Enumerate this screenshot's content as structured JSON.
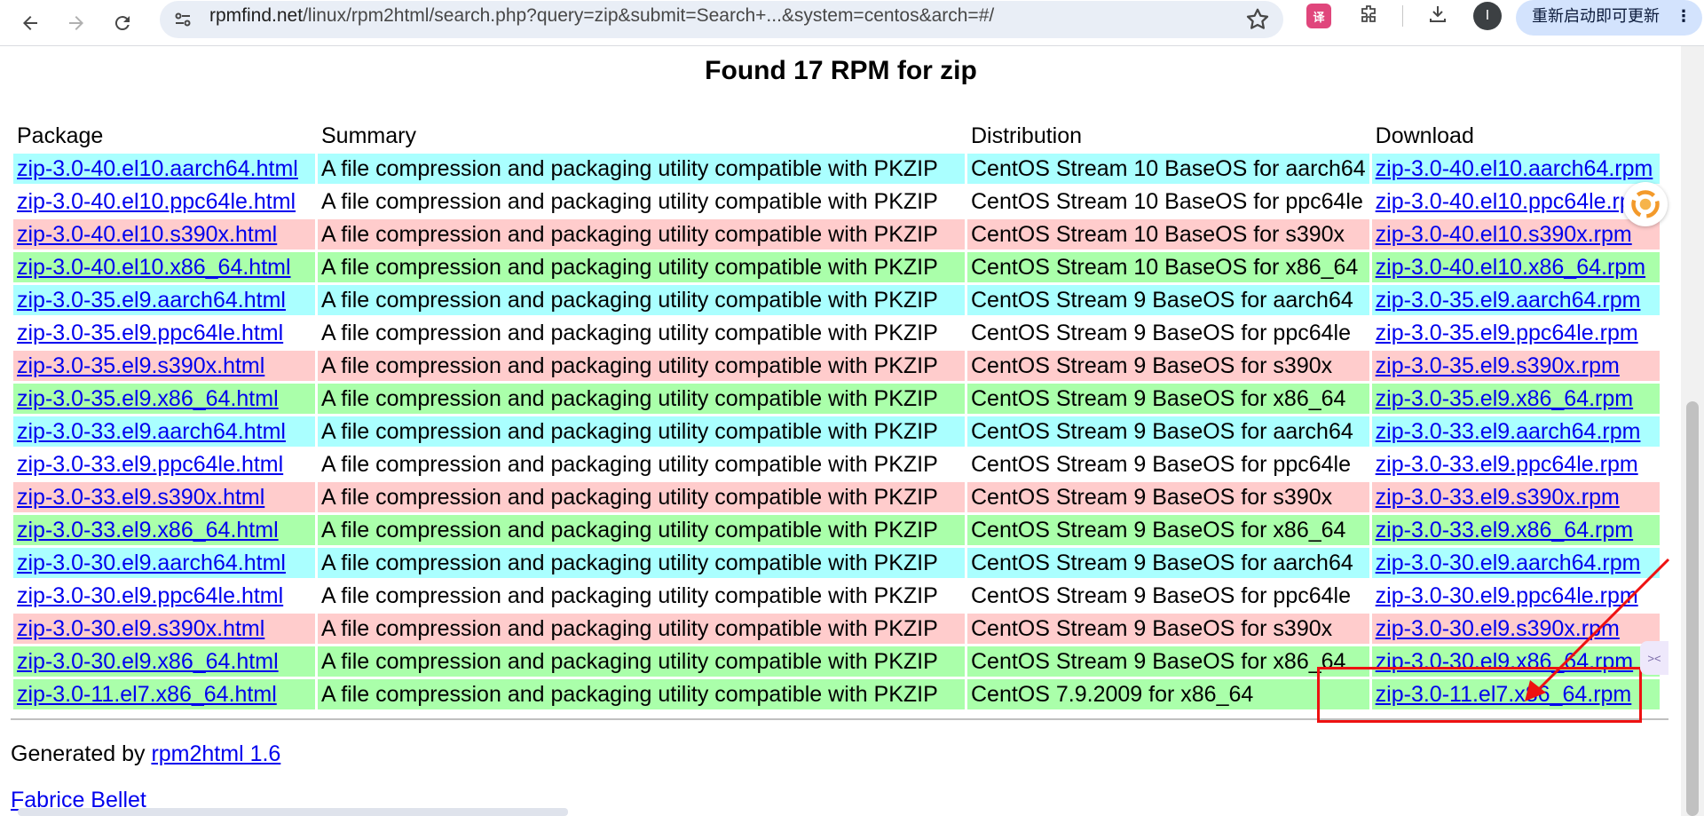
{
  "browser": {
    "url_host": "rpmfind.net",
    "url_path": "/linux/rpm2html/search.php?query=zip&submit=Search+...&system=centos&arch=#/",
    "ext_translate": "译",
    "avatar_initial": "I",
    "update_label": "重新启动即可更新",
    "update_menu": "⋮"
  },
  "page": {
    "heading": "Found 17 RPM for zip",
    "columns": {
      "package": "Package",
      "summary": "Summary",
      "distribution": "Distribution",
      "download": "Download"
    },
    "rows": [
      {
        "package": "zip-3.0-40.el10.aarch64.html",
        "summary": "A file compression and packaging utility compatible with PKZIP",
        "distribution": "CentOS Stream 10 BaseOS for aarch64",
        "download": "zip-3.0-40.el10.aarch64.rpm",
        "color": "cyan"
      },
      {
        "package": "zip-3.0-40.el10.ppc64le.html",
        "summary": "A file compression and packaging utility compatible with PKZIP",
        "distribution": "CentOS Stream 10 BaseOS for ppc64le",
        "download": "zip-3.0-40.el10.ppc64le.rpm",
        "color": "white"
      },
      {
        "package": "zip-3.0-40.el10.s390x.html",
        "summary": "A file compression and packaging utility compatible with PKZIP",
        "distribution": "CentOS Stream 10 BaseOS for s390x",
        "download": "zip-3.0-40.el10.s390x.rpm",
        "color": "pink"
      },
      {
        "package": "zip-3.0-40.el10.x86_64.html",
        "summary": "A file compression and packaging utility compatible with PKZIP",
        "distribution": "CentOS Stream 10 BaseOS for x86_64",
        "download": "zip-3.0-40.el10.x86_64.rpm",
        "color": "green"
      },
      {
        "package": "zip-3.0-35.el9.aarch64.html",
        "summary": "A file compression and packaging utility compatible with PKZIP",
        "distribution": "CentOS Stream 9 BaseOS for aarch64",
        "download": "zip-3.0-35.el9.aarch64.rpm",
        "color": "cyan"
      },
      {
        "package": "zip-3.0-35.el9.ppc64le.html",
        "summary": "A file compression and packaging utility compatible with PKZIP",
        "distribution": "CentOS Stream 9 BaseOS for ppc64le",
        "download": "zip-3.0-35.el9.ppc64le.rpm",
        "color": "white"
      },
      {
        "package": "zip-3.0-35.el9.s390x.html",
        "summary": "A file compression and packaging utility compatible with PKZIP",
        "distribution": "CentOS Stream 9 BaseOS for s390x",
        "download": "zip-3.0-35.el9.s390x.rpm",
        "color": "pink"
      },
      {
        "package": "zip-3.0-35.el9.x86_64.html",
        "summary": "A file compression and packaging utility compatible with PKZIP",
        "distribution": "CentOS Stream 9 BaseOS for x86_64",
        "download": "zip-3.0-35.el9.x86_64.rpm",
        "color": "green"
      },
      {
        "package": "zip-3.0-33.el9.aarch64.html",
        "summary": "A file compression and packaging utility compatible with PKZIP",
        "distribution": "CentOS Stream 9 BaseOS for aarch64",
        "download": "zip-3.0-33.el9.aarch64.rpm",
        "color": "cyan"
      },
      {
        "package": "zip-3.0-33.el9.ppc64le.html",
        "summary": "A file compression and packaging utility compatible with PKZIP",
        "distribution": "CentOS Stream 9 BaseOS for ppc64le",
        "download": "zip-3.0-33.el9.ppc64le.rpm",
        "color": "white"
      },
      {
        "package": "zip-3.0-33.el9.s390x.html",
        "summary": "A file compression and packaging utility compatible with PKZIP",
        "distribution": "CentOS Stream 9 BaseOS for s390x",
        "download": "zip-3.0-33.el9.s390x.rpm",
        "color": "pink"
      },
      {
        "package": "zip-3.0-33.el9.x86_64.html",
        "summary": "A file compression and packaging utility compatible with PKZIP",
        "distribution": "CentOS Stream 9 BaseOS for x86_64",
        "download": "zip-3.0-33.el9.x86_64.rpm",
        "color": "green"
      },
      {
        "package": "zip-3.0-30.el9.aarch64.html",
        "summary": "A file compression and packaging utility compatible with PKZIP",
        "distribution": "CentOS Stream 9 BaseOS for aarch64",
        "download": "zip-3.0-30.el9.aarch64.rpm",
        "color": "cyan"
      },
      {
        "package": "zip-3.0-30.el9.ppc64le.html",
        "summary": "A file compression and packaging utility compatible with PKZIP",
        "distribution": "CentOS Stream 9 BaseOS for ppc64le",
        "download": "zip-3.0-30.el9.ppc64le.rpm",
        "color": "white"
      },
      {
        "package": "zip-3.0-30.el9.s390x.html",
        "summary": "A file compression and packaging utility compatible with PKZIP",
        "distribution": "CentOS Stream 9 BaseOS for s390x",
        "download": "zip-3.0-30.el9.s390x.rpm",
        "color": "pink"
      },
      {
        "package": "zip-3.0-30.el9.x86_64.html",
        "summary": "A file compression and packaging utility compatible with PKZIP",
        "distribution": "CentOS Stream 9 BaseOS for x86_64",
        "download": "zip-3.0-30.el9.x86_64.rpm",
        "color": "green"
      },
      {
        "package": "zip-3.0-11.el7.x86_64.html",
        "summary": "A file compression and packaging utility compatible with PKZIP",
        "distribution": "CentOS 7.9.2009 for x86_64",
        "download": "zip-3.0-11.el7.x86_64.rpm",
        "color": "green"
      }
    ],
    "footer": {
      "generated_prefix": "Generated by ",
      "generated_link": "rpm2html 1.6",
      "author_link": "Fabrice Bellet"
    }
  },
  "colors": {
    "cyan_row": "#aaffff",
    "white_row": "#ffffff",
    "pink_row": "#ffcccc",
    "green_row": "#aaffaa",
    "link": "#0000ee",
    "annotation": "#ee1111"
  },
  "icons": {
    "back": "back-arrow-icon",
    "forward": "forward-arrow-icon",
    "reload": "reload-icon",
    "site_info": "site-settings-icon",
    "bookmark": "star-icon",
    "extensions": "puzzle-icon",
    "download": "download-icon"
  }
}
